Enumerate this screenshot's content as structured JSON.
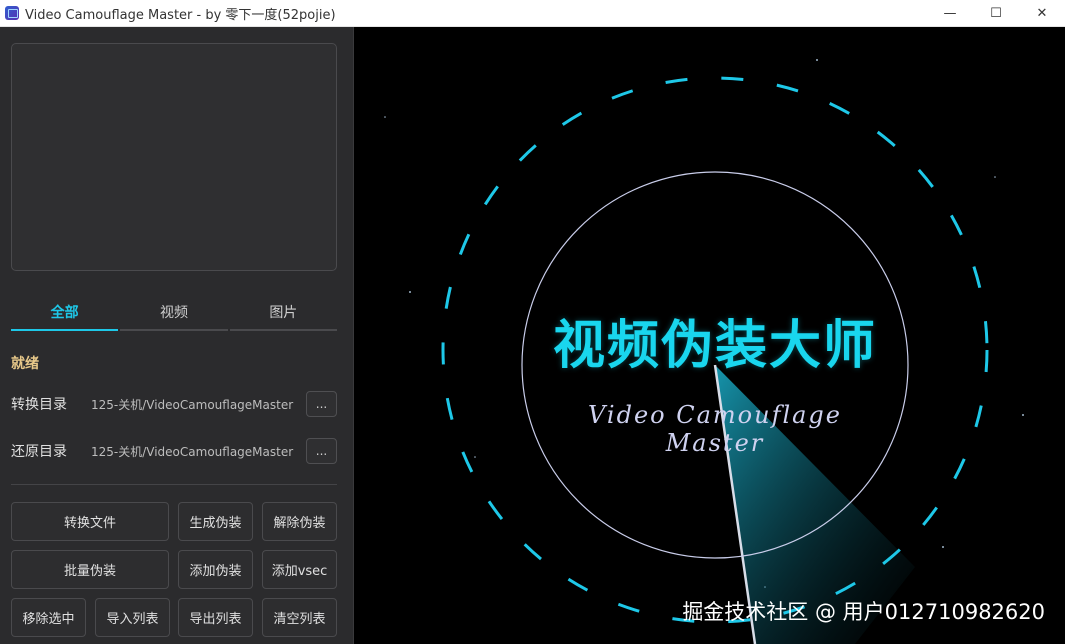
{
  "window": {
    "title": "Video Camouflage Master - by 零下一度(52pojie)",
    "minimize": "—",
    "maximize": "☐",
    "close": "✕"
  },
  "tabs": [
    {
      "label": "全部",
      "active": true
    },
    {
      "label": "视频",
      "active": false
    },
    {
      "label": "图片",
      "active": false
    }
  ],
  "status": "就绪",
  "convert_dir": {
    "label": "转换目录",
    "path": "125-关机/VideoCamouflageMaster",
    "browse": "..."
  },
  "restore_dir": {
    "label": "还原目录",
    "path": "125-关机/VideoCamouflageMaster",
    "browse": "..."
  },
  "buttons": {
    "convert_file": "转换文件",
    "generate": "生成伪装",
    "remove": "解除伪装",
    "batch": "批量伪装",
    "add": "添加伪装",
    "add_vsec": "添加vsec",
    "remove_selected": "移除选中",
    "import_list": "导入列表",
    "export_list": "导出列表",
    "clear_list": "清空列表"
  },
  "art": {
    "title": "视频伪装大师",
    "subtitle": "Video Camouflage Master",
    "watermark": "掘金技术社区 @ 用户012710982620",
    "accent": "#19d6ee"
  }
}
